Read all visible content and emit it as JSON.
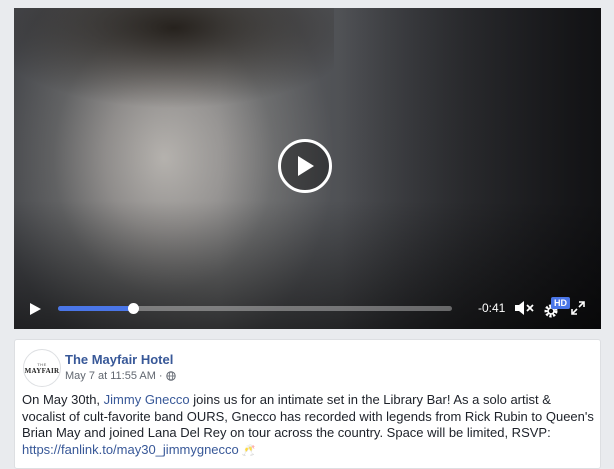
{
  "video": {
    "time_remaining": "-0:41",
    "progress_fraction": 0.19,
    "quality_badge": "HD",
    "icons": {
      "center_play": "play-circle-icon",
      "play": "play-icon",
      "volume": "volume-muted-icon",
      "settings": "gear-icon",
      "fullscreen": "fullscreen-icon"
    }
  },
  "post": {
    "page_name": "The Mayfair Hotel",
    "avatar_text_small": "THE",
    "avatar_text_logo": "MAYFAIR",
    "timestamp": "May 7 at 11:55 AM",
    "separator": "·",
    "privacy_icon": "globe-icon",
    "text_before_mention": "On May 30th, ",
    "mention": "Jimmy Gnecco",
    "text_after_mention": " joins us for an intimate set in the Library Bar! As a solo artist & vocalist of cult-favorite band OURS, Gnecco has recorded with legends from Rick Rubin to Queen's Brian May and joined Lana Del Rey on tour across the country. Space will be limited, RSVP:",
    "link": "https://fanlink.to/may30_jimmygnecco",
    "emoji": "🥂"
  },
  "colors": {
    "link": "#385898",
    "progress_fill": "#4a76e8",
    "page_bg": "#e9ebee"
  }
}
